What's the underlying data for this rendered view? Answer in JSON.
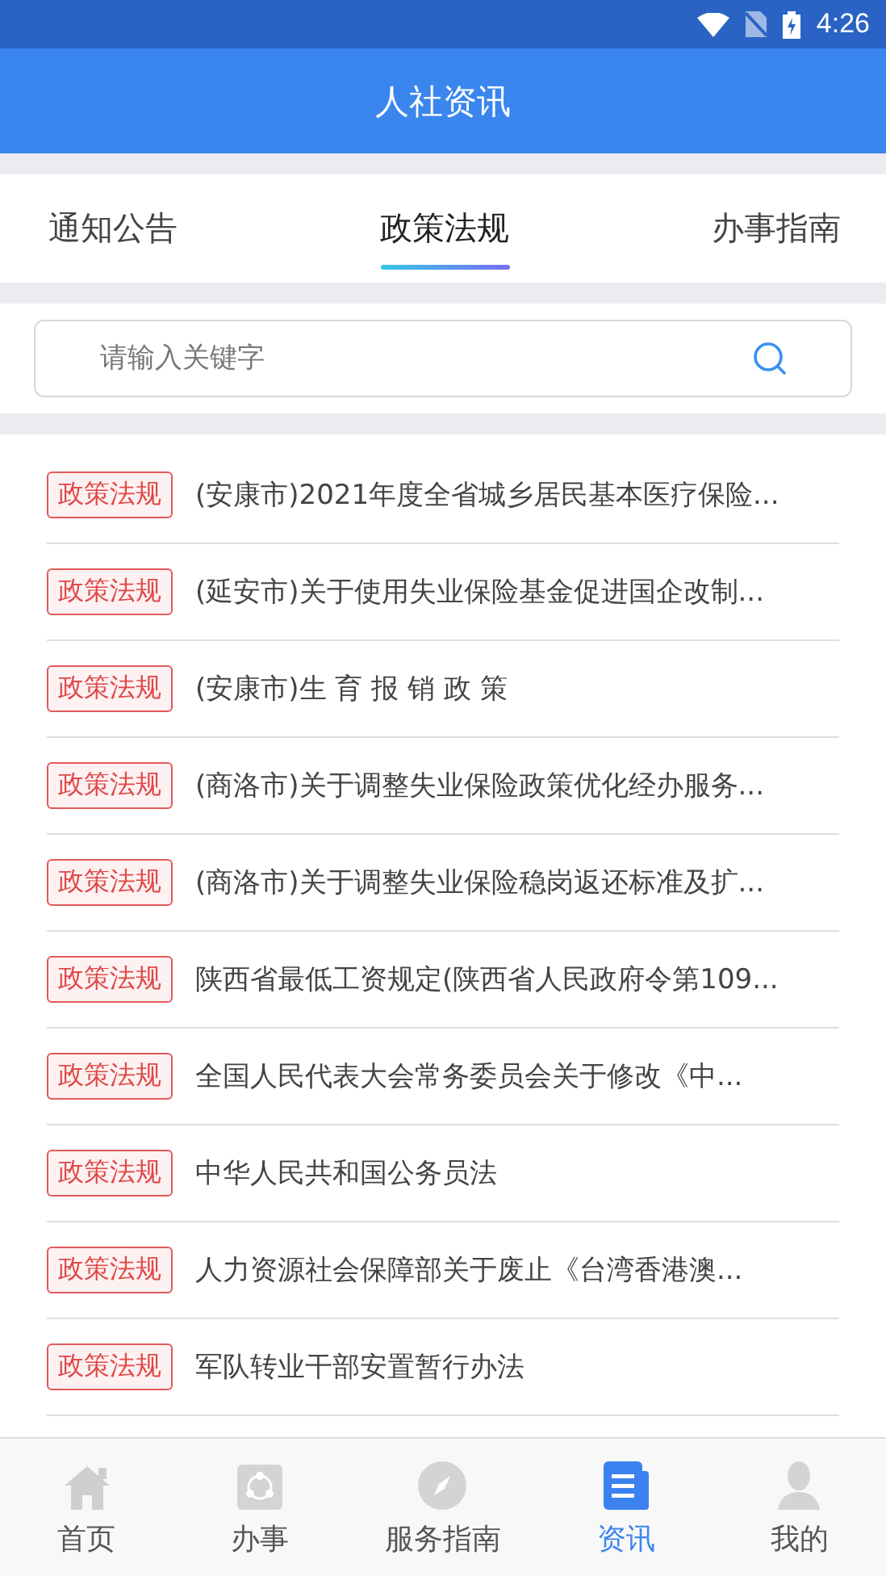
{
  "status_bar": {
    "time": "4:26"
  },
  "header": {
    "title": "人社资讯"
  },
  "tabs": [
    {
      "label": "通知公告",
      "selected": false
    },
    {
      "label": "政策法规",
      "selected": true
    },
    {
      "label": "办事指南",
      "selected": false
    }
  ],
  "search": {
    "placeholder": "请输入关键字"
  },
  "articles": [
    {
      "tag": "政策法规",
      "title": "(安康市)2021年度全省城乡居民基本医疗保险..."
    },
    {
      "tag": "政策法规",
      "title": "(延安市)关于使用失业保险基金促进国企改制..."
    },
    {
      "tag": "政策法规",
      "title": "(安康市)生 育 报 销 政 策"
    },
    {
      "tag": "政策法规",
      "title": "(商洛市)关于调整失业保险政策优化经办服务..."
    },
    {
      "tag": "政策法规",
      "title": "(商洛市)关于调整失业保险稳岗返还标准及扩..."
    },
    {
      "tag": "政策法规",
      "title": "陕西省最低工资规定(陕西省人民政府令第109..."
    },
    {
      "tag": "政策法规",
      "title": "全国人民代表大会常务委员会关于修改《中..."
    },
    {
      "tag": "政策法规",
      "title": "中华人民共和国公务员法"
    },
    {
      "tag": "政策法规",
      "title": "人力资源社会保障部关于废止《台湾香港澳..."
    },
    {
      "tag": "政策法规",
      "title": "军队转业干部安置暂行办法"
    }
  ],
  "bottom_nav": [
    {
      "kind": "home",
      "label": "首页",
      "selected": false
    },
    {
      "kind": "tasks",
      "label": "办事",
      "selected": false
    },
    {
      "kind": "compass",
      "label": "服务指南",
      "selected": false
    },
    {
      "kind": "news",
      "label": "资讯",
      "selected": true
    },
    {
      "kind": "person",
      "label": "我的",
      "selected": false
    }
  ]
}
